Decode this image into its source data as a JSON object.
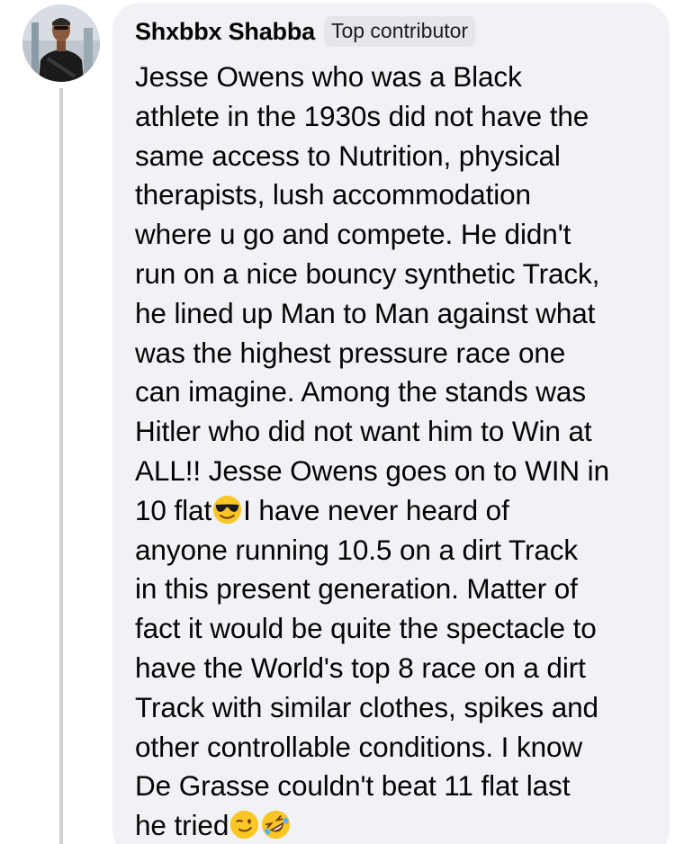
{
  "comment": {
    "author": "Shxbbx Shabba",
    "badge": "Top contributor",
    "text_lines": [
      "Jesse Owens who was a Black",
      "athlete in the 1930s did not have the",
      "same access to Nutrition, physical",
      "therapists, lush accommodation",
      "where u go and compete. He didn't",
      "run on a nice bouncy synthetic Track,",
      "he lined up Man to Man against what",
      "was the highest pressure race one",
      "can imagine. Among the stands was",
      "Hitler who did not want him to Win at",
      "ALL!! Jesse Owens goes on to WIN in",
      "10 flat",
      "I have never heard of",
      "anyone running 10.5 on a dirt Track",
      "in this present generation. Matter of",
      "fact it would be quite the spectacle to",
      "have the World's top 8 race on a dirt",
      "Track with similar clothes, spikes and",
      "other controllable conditions. I know",
      "De Grasse couldn't beat 11 flat last",
      "he tried"
    ],
    "emojis": {
      "sunglasses": "smiling-face-with-sunglasses-emoji",
      "wink": "winking-face-emoji",
      "laughing": "rolling-on-floor-laughing-emoji"
    }
  },
  "colors": {
    "bubble_bg": "#f0f2f5",
    "badge_bg": "#e4e6eb",
    "text": "#050505",
    "thread_line": "#ced0d4"
  }
}
